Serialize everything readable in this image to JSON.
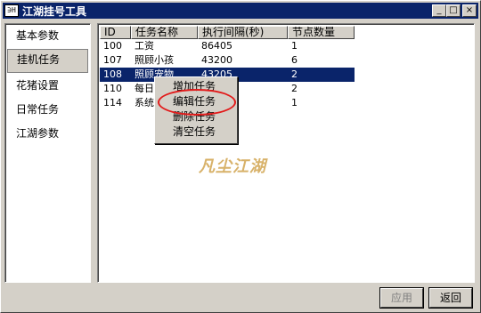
{
  "window": {
    "title": "江湖挂号工具",
    "icon_label": "∋H",
    "minimize_glyph": "_",
    "maximize_glyph": "□",
    "close_glyph": "×"
  },
  "sidebar": {
    "items": [
      {
        "label": "基本参数",
        "active": false
      },
      {
        "label": "挂机任务",
        "active": true
      },
      {
        "label": "花猪设置",
        "active": false
      },
      {
        "label": "日常任务",
        "active": false
      },
      {
        "label": "江湖参数",
        "active": false
      }
    ]
  },
  "task_table": {
    "columns": [
      "ID",
      "任务名称",
      "执行间隔(秒)",
      "节点数量"
    ],
    "rows": [
      [
        "100",
        "工资",
        "86405",
        "1"
      ],
      [
        "107",
        "照顾小孩",
        "43200",
        "6"
      ],
      [
        "108",
        "照顾宠物",
        "43205",
        "2"
      ],
      [
        "110",
        "每日",
        "",
        "2"
      ],
      [
        "114",
        "系统",
        "",
        "1"
      ]
    ],
    "selected_row": 2
  },
  "context_menu": {
    "items": [
      "增加任务",
      "编辑任务",
      "删除任务",
      "清空任务"
    ],
    "highlighted_item": "编辑任务",
    "highlight_color": "#e21b1b"
  },
  "watermark": {
    "text": "凡尘江湖"
  },
  "footer": {
    "apply_label": "应用",
    "apply_enabled": false,
    "back_label": "返回"
  },
  "colors": {
    "titlebar": "#0a246a",
    "selection": "#0a246a",
    "face": "#d4d0c8"
  }
}
